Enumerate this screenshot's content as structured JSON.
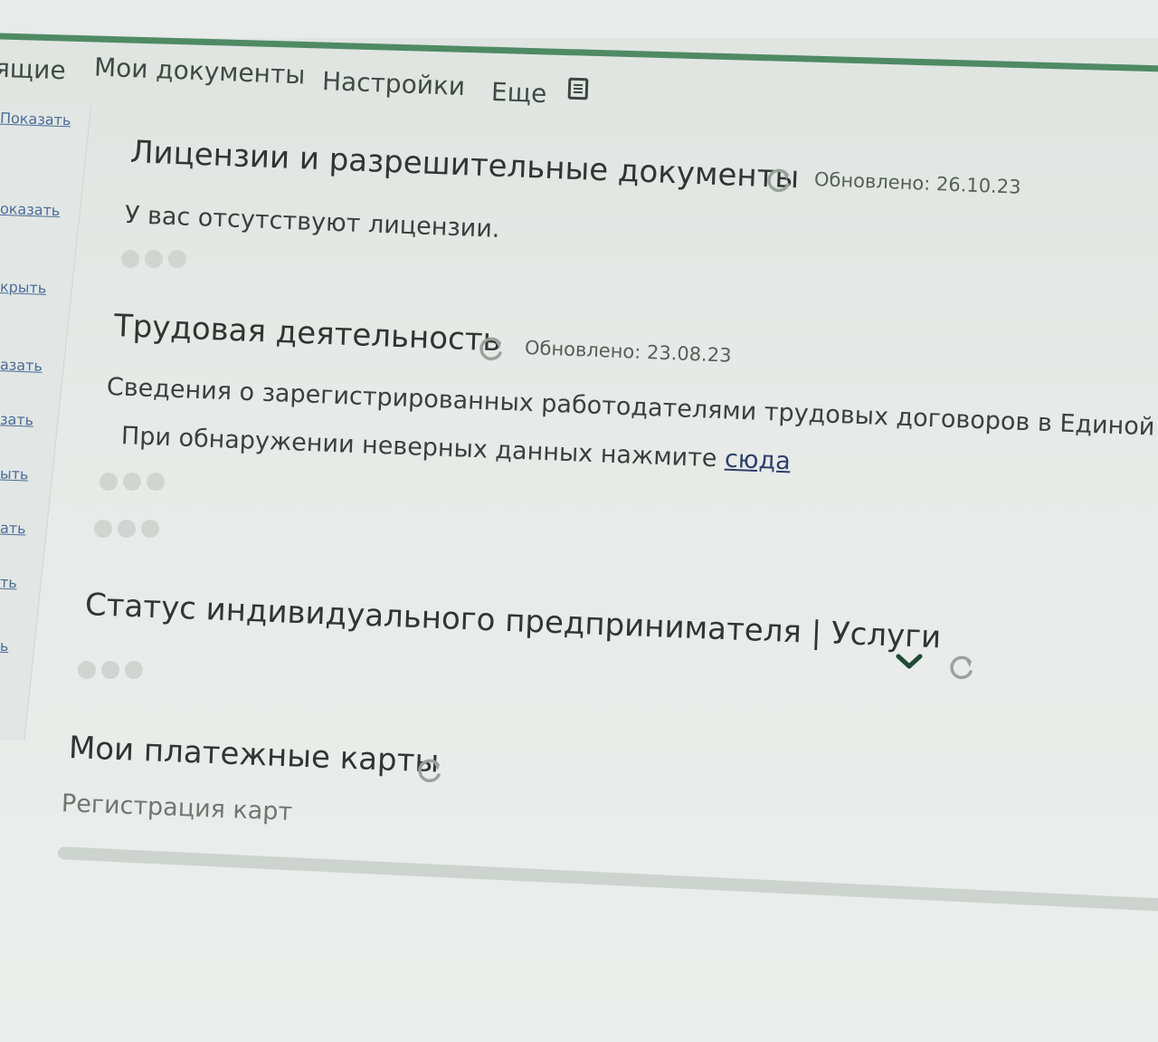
{
  "nav": {
    "items": [
      {
        "label": "ящие"
      },
      {
        "label": "Мои документы"
      },
      {
        "label": "Настройки"
      },
      {
        "label": "Еще"
      }
    ],
    "menu_icon": "menu-list-icon"
  },
  "sidebar": {
    "links": [
      {
        "label": "Показать"
      },
      {
        "label": "оказать"
      },
      {
        "label": "крыть"
      },
      {
        "label": "азать"
      },
      {
        "label": "зать"
      },
      {
        "label": "ыть"
      },
      {
        "label": "ать"
      },
      {
        "label": "ть"
      },
      {
        "label": "ь"
      }
    ]
  },
  "sections": {
    "licenses": {
      "title": "Лицензии и разрешительные документы",
      "updated": "Обновлено: 26.10.23",
      "text": "У вас отсутствуют лицензии."
    },
    "employment": {
      "title": "Трудовая деятельность",
      "updated": "Обновлено: 23.08.23",
      "text_line1": "Сведения о зарегистрированных работодателями трудовых договоров в Единой",
      "text_line2_prefix": "При обнаружении неверных данных нажмите ",
      "link": "сюда"
    },
    "ip_status": {
      "title": "Статус индивидуального предпринимателя | Услуги"
    },
    "cards": {
      "title": "Мои платежные карты",
      "subtitle": "Регистрация карт"
    }
  },
  "icons": {
    "refresh": "refresh-icon",
    "chevron": "chevron-down-icon"
  },
  "colors": {
    "accent_green": "#4f8a64",
    "link_blue": "#2b3f6b"
  }
}
